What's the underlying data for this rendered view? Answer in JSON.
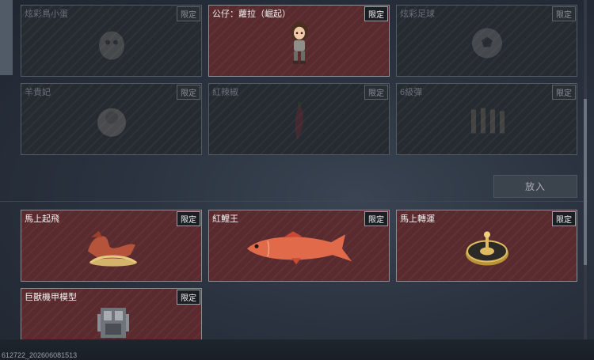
{
  "top_section": {
    "items": [
      {
        "name": "炫彩鳥小蛋",
        "badge": "限定",
        "icon": "egg-creature-icon"
      },
      {
        "name": "公仔：蘿拉（崛起）",
        "badge": "限定",
        "icon": "lara-figure-icon"
      },
      {
        "name": "炫彩足球",
        "badge": "限定",
        "icon": "football-icon"
      },
      {
        "name": "羊貴妃",
        "badge": "限定",
        "icon": "sheep-icon"
      },
      {
        "name": "紅辣椒",
        "badge": "限定",
        "icon": "chili-icon"
      },
      {
        "name": "6級彈",
        "badge": "限定",
        "icon": "bullet-icon"
      }
    ]
  },
  "place_button": {
    "label": "放入"
  },
  "bottom_section": {
    "items": [
      {
        "name": "馬上起飛",
        "badge": "限定",
        "icon": "horse-statue-icon"
      },
      {
        "name": "紅鯉王",
        "badge": "限定",
        "icon": "red-carp-icon"
      },
      {
        "name": "馬上轉運",
        "badge": "限定",
        "icon": "golden-wheel-icon"
      },
      {
        "name": "巨獸機甲模型",
        "badge": "限定",
        "icon": "mech-model-icon"
      }
    ]
  },
  "footer": {
    "build_id": "612722_202606081513"
  },
  "colors": {
    "owned_card": "#5a2b2e",
    "dim_card": "#262b32",
    "background": "#2b3340"
  }
}
